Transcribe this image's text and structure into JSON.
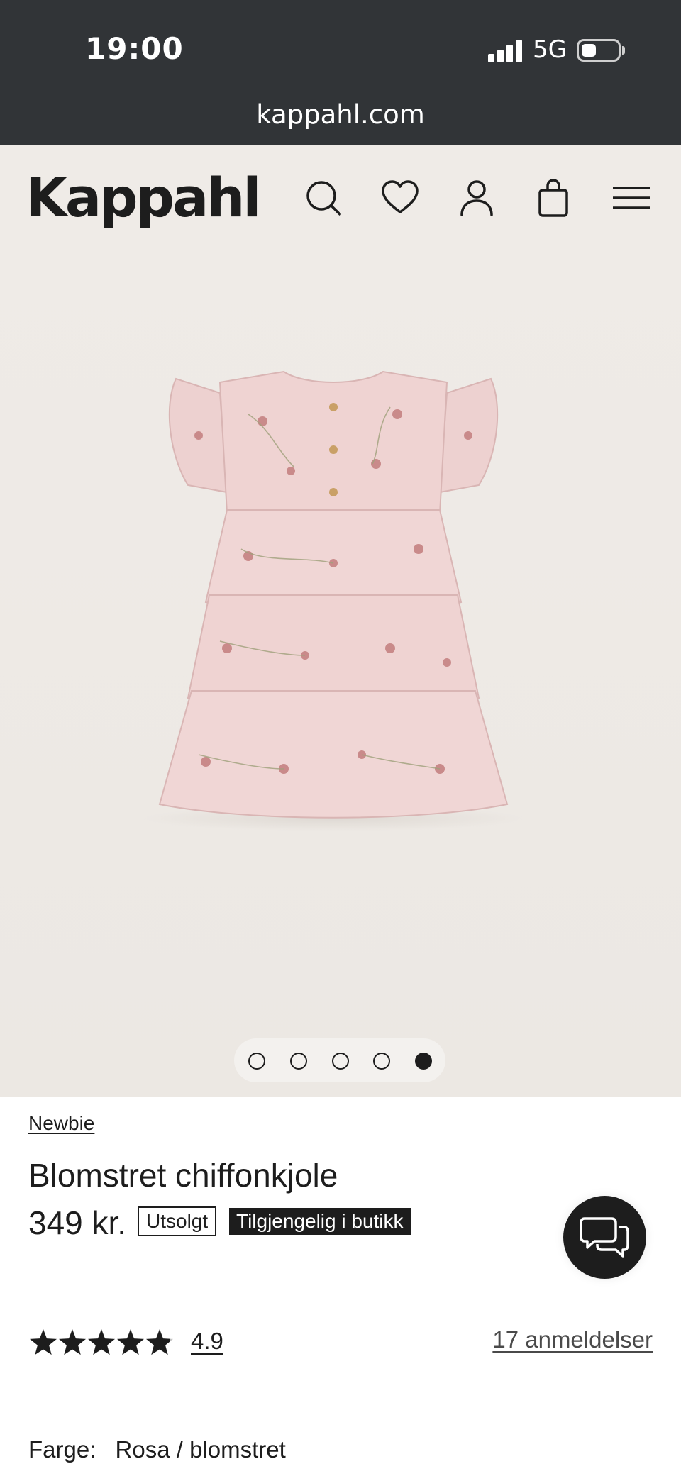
{
  "status_bar": {
    "time": "19:00",
    "network": "5G",
    "url": "kappahl.com"
  },
  "header": {
    "logo": "Kappahl",
    "icons": [
      "search-icon",
      "heart-icon",
      "user-icon",
      "bag-icon",
      "menu-icon"
    ]
  },
  "carousel": {
    "slide_count": 5,
    "active_index": 4
  },
  "product": {
    "brand": "Newbie",
    "title": "Blomstret chiffonkjole",
    "price": "349 kr.",
    "badge_sold_out": "Utsolgt",
    "badge_in_store": "Tilgjengelig i butikk"
  },
  "rating": {
    "value": "4.9",
    "stars_fraction": 0.98,
    "reviews_label": "17 anmeldelser"
  },
  "color": {
    "label": "Farge:",
    "value": "Rosa / blomstret"
  },
  "colors": {
    "status_bar_bg": "#313437",
    "header_bg": "#efebe7",
    "text": "#1d1d1d",
    "dress_pink": "#efd3d2",
    "flower": "#c98a8a"
  }
}
